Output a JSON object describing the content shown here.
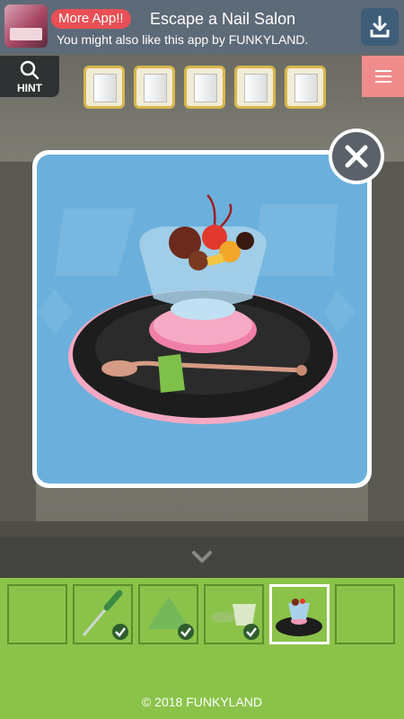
{
  "ad": {
    "badge": "More App!!",
    "title": "Escape a Nail Salon",
    "subtitle": "You might also like this app by FUNKYLAND.",
    "download_icon": "download-icon"
  },
  "hint": {
    "label": "HINT",
    "icon": "search-icon"
  },
  "item_slots": [
    {
      "item": "white-card"
    },
    {
      "item": "white-card"
    },
    {
      "item": "white-card"
    },
    {
      "item": "white-card"
    },
    {
      "item": "white-card"
    }
  ],
  "menu": {
    "icon": "hamburger-icon"
  },
  "popup": {
    "item": "fruit-parfait-on-tray",
    "close_icon": "close-icon"
  },
  "arrow": {
    "icon": "chevron-down-icon"
  },
  "inventory": [
    {
      "item": "",
      "checked": false
    },
    {
      "item": "screwdriver",
      "checked": true
    },
    {
      "item": "green-triangle",
      "checked": true
    },
    {
      "item": "glass-and-soap",
      "checked": true
    },
    {
      "item": "parfait-tray",
      "checked": false,
      "selected": true
    },
    {
      "item": "",
      "checked": false
    }
  ],
  "footer": {
    "copyright": "© 2018 FUNKYLAND"
  },
  "colors": {
    "inventory_bg": "#8bc34a",
    "menu_button": "#f08c8c",
    "popup_bg": "#6bb0dc",
    "ad_badge": "#e94f55"
  }
}
